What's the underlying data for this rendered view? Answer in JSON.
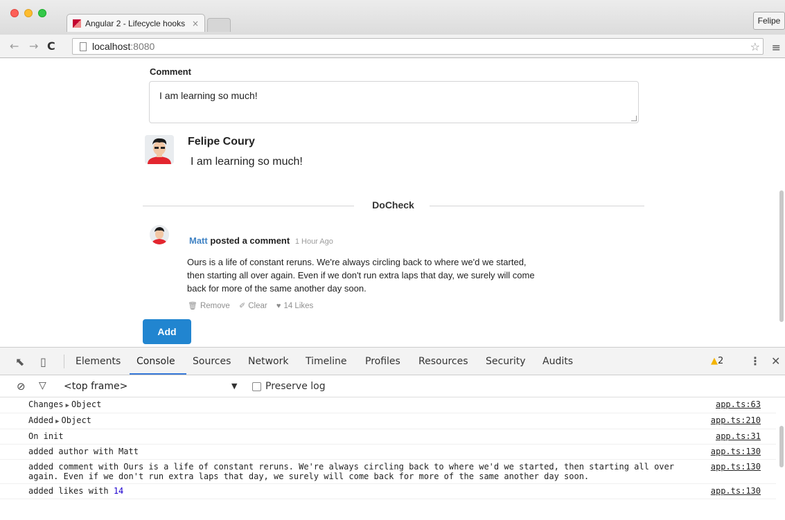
{
  "browser": {
    "tab_title": "Angular 2 - Lifecycle hooks",
    "tab_close": "×",
    "profile": "Felipe",
    "url_host": "localhost",
    "url_port": ":8080",
    "back": "←",
    "forward": "→",
    "reload": "C",
    "star": "☆",
    "menu": "≡"
  },
  "form": {
    "label": "Comment",
    "textarea_value": "I am learning so much!"
  },
  "preview": {
    "author": "Felipe Coury",
    "text": "I am learning so much!"
  },
  "section": {
    "divider": "DoCheck"
  },
  "comment": {
    "author": "Matt",
    "action": "posted a comment",
    "date": "1 Hour Ago",
    "text": "Ours is a life of constant reruns. We're always circling back to where we'd we started, then starting all over again. Even if we don't run extra laps that day, we surely will come back for more of the same another day soon.",
    "remove": "Remove",
    "clear": "Clear",
    "likes": "14 Likes"
  },
  "add_button": "Add",
  "devtools": {
    "tabs": [
      "Elements",
      "Console",
      "Sources",
      "Network",
      "Timeline",
      "Profiles",
      "Resources",
      "Security",
      "Audits"
    ],
    "active_tab": "Console",
    "warnings": "2",
    "frame": "<top frame>",
    "preserve_log": "Preserve log",
    "logs": [
      {
        "text": "Changes",
        "obj": "Object",
        "src": "app.ts:63"
      },
      {
        "text": "Added",
        "obj": "Object",
        "src": "app.ts:210"
      },
      {
        "text": "On init",
        "src": "app.ts:31"
      },
      {
        "text": "added author with Matt",
        "src": "app.ts:130"
      },
      {
        "text": "added comment with Ours is a life of constant reruns. We're always circling back to where we'd we started, then starting all over again. Even if we don't run extra laps that day, we surely will come back for more of the same another day soon.",
        "src": "app.ts:130"
      },
      {
        "text": "added likes with",
        "num": "14",
        "src": "app.ts:130"
      }
    ]
  },
  "colors": {
    "primary_button": "#2185d0",
    "author_link": "#4183c4",
    "active_tab_underline": "#3879d9"
  }
}
